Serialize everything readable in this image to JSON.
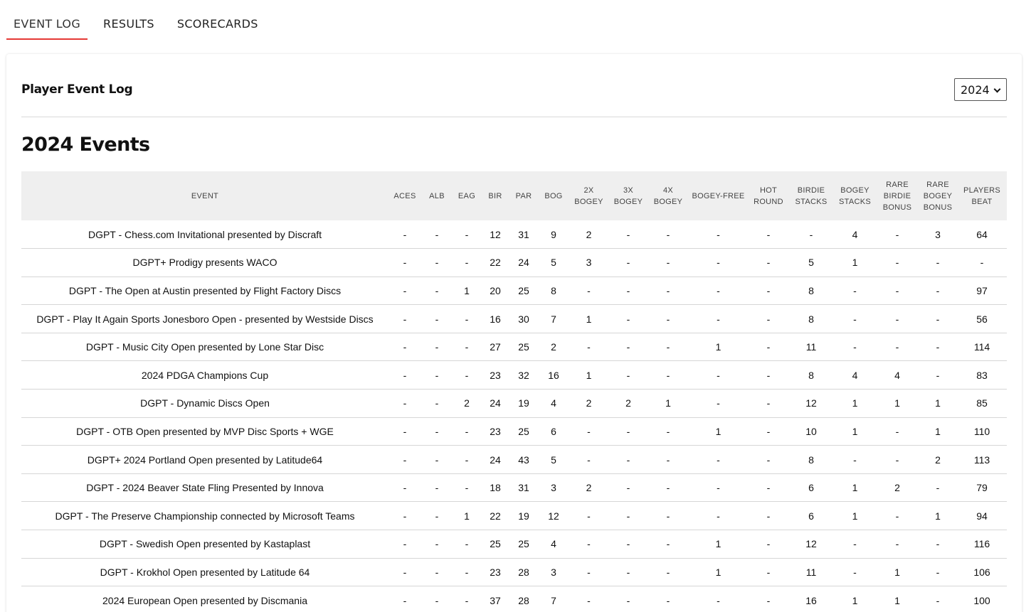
{
  "tabs": [
    {
      "label": "EVENT LOG",
      "active": true
    },
    {
      "label": "RESULTS",
      "active": false
    },
    {
      "label": "SCORECARDS",
      "active": false
    }
  ],
  "card": {
    "title": "Player Event Log",
    "year_select": {
      "value": "2024"
    }
  },
  "section_title": "2024 Events",
  "colors": {
    "accent": "#e53935",
    "header_bg": "#efefef",
    "row_border": "#d6d6d6"
  },
  "table": {
    "columns": [
      "EVENT",
      "ACES",
      "ALB",
      "EAG",
      "BIR",
      "PAR",
      "BOG",
      "2X BOGEY",
      "3X BOGEY",
      "4X BOGEY",
      "BOGEY-FREE",
      "HOT ROUND",
      "BIRDIE STACKS",
      "BOGEY STACKS",
      "RARE BIRDIE BONUS",
      "RARE BOGEY BONUS",
      "PLAYERS BEAT"
    ],
    "rows": [
      [
        "DGPT - Chess.com Invitational presented by Discraft",
        "-",
        "-",
        "-",
        "12",
        "31",
        "9",
        "2",
        "-",
        "-",
        "-",
        "-",
        "-",
        "4",
        "-",
        "3",
        "64"
      ],
      [
        "DGPT+ Prodigy presents WACO",
        "-",
        "-",
        "-",
        "22",
        "24",
        "5",
        "3",
        "-",
        "-",
        "-",
        "-",
        "5",
        "1",
        "-",
        "-",
        "-"
      ],
      [
        "DGPT - The Open at Austin presented by Flight Factory Discs",
        "-",
        "-",
        "1",
        "20",
        "25",
        "8",
        "-",
        "-",
        "-",
        "-",
        "-",
        "8",
        "-",
        "-",
        "-",
        "97"
      ],
      [
        "DGPT - Play It Again Sports Jonesboro Open - presented by Westside Discs",
        "-",
        "-",
        "-",
        "16",
        "30",
        "7",
        "1",
        "-",
        "-",
        "-",
        "-",
        "8",
        "-",
        "-",
        "-",
        "56"
      ],
      [
        "DGPT - Music City Open presented by Lone Star Disc",
        "-",
        "-",
        "-",
        "27",
        "25",
        "2",
        "-",
        "-",
        "-",
        "1",
        "-",
        "11",
        "-",
        "-",
        "-",
        "114"
      ],
      [
        "2024 PDGA Champions Cup",
        "-",
        "-",
        "-",
        "23",
        "32",
        "16",
        "1",
        "-",
        "-",
        "-",
        "-",
        "8",
        "4",
        "4",
        "-",
        "83"
      ],
      [
        "DGPT - Dynamic Discs Open",
        "-",
        "-",
        "2",
        "24",
        "19",
        "4",
        "2",
        "2",
        "1",
        "-",
        "-",
        "12",
        "1",
        "1",
        "1",
        "85"
      ],
      [
        "DGPT - OTB Open presented by MVP Disc Sports + WGE",
        "-",
        "-",
        "-",
        "23",
        "25",
        "6",
        "-",
        "-",
        "-",
        "1",
        "-",
        "10",
        "1",
        "-",
        "1",
        "110"
      ],
      [
        "DGPT+ 2024 Portland Open presented by Latitude64",
        "-",
        "-",
        "-",
        "24",
        "43",
        "5",
        "-",
        "-",
        "-",
        "-",
        "-",
        "8",
        "-",
        "-",
        "2",
        "113"
      ],
      [
        "DGPT - 2024 Beaver State Fling Presented by Innova",
        "-",
        "-",
        "-",
        "18",
        "31",
        "3",
        "2",
        "-",
        "-",
        "-",
        "-",
        "6",
        "1",
        "2",
        "-",
        "79"
      ],
      [
        "DGPT - The Preserve Championship connected by Microsoft Teams",
        "-",
        "-",
        "1",
        "22",
        "19",
        "12",
        "-",
        "-",
        "-",
        "-",
        "-",
        "6",
        "1",
        "-",
        "1",
        "94"
      ],
      [
        "DGPT - Swedish Open presented by Kastaplast",
        "-",
        "-",
        "-",
        "25",
        "25",
        "4",
        "-",
        "-",
        "-",
        "1",
        "-",
        "12",
        "-",
        "-",
        "-",
        "116"
      ],
      [
        "DGPT - Krokhol Open presented by Latitude 64",
        "-",
        "-",
        "-",
        "23",
        "28",
        "3",
        "-",
        "-",
        "-",
        "1",
        "-",
        "11",
        "-",
        "1",
        "-",
        "106"
      ],
      [
        "2024 European Open presented by Discmania",
        "-",
        "-",
        "-",
        "37",
        "28",
        "7",
        "-",
        "-",
        "-",
        "-",
        "-",
        "16",
        "1",
        "1",
        "-",
        "100"
      ]
    ]
  }
}
